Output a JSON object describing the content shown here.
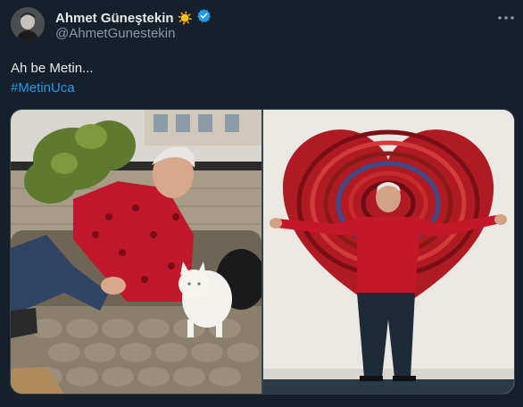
{
  "tweet": {
    "author_name": "Ahmet Güneştekin",
    "name_emoji": "☀️",
    "handle": "@AhmetGunestekin",
    "text_line": "Ah be Metin...",
    "hashtag": "#MetinUca"
  },
  "icons": {
    "verified": "verified-badge-icon",
    "more": "more-options-icon",
    "avatar": "avatar"
  },
  "colors": {
    "background": "#15202b",
    "hashtag": "#1d9bf0",
    "verified": "#1d9bf0",
    "secondary_text": "#8b98a5"
  },
  "media": {
    "count": 2,
    "photos": [
      {
        "name": "photo-man-with-white-cat"
      },
      {
        "name": "photo-man-before-red-heart-artwork"
      }
    ]
  }
}
